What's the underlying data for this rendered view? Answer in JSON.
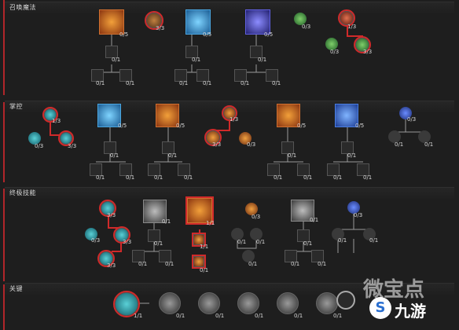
{
  "sections": [
    {
      "title": "召唤魔法"
    },
    {
      "title": "掌控"
    },
    {
      "title": "终极技能"
    },
    {
      "title": "关键"
    }
  ],
  "summoning": {
    "skills": [
      {
        "label": "0/5",
        "icon": "summon-skeleton-icon",
        "color": "#c0591c"
      },
      {
        "label": "3/3",
        "icon": "mod-icon",
        "color": "#c0591c"
      },
      {
        "label": "0/5",
        "icon": "summon-golem-icon",
        "color": "#2a86c4"
      },
      {
        "label": "0/5",
        "icon": "summon-mage-icon",
        "color": "#4a4ad0"
      },
      {
        "label": "0/3",
        "icon": "passive-green-icon",
        "color": "#2c7a3a"
      },
      {
        "label": "1/3",
        "icon": "passive-red-icon",
        "color": "#b83a2a"
      },
      {
        "label": "0/3",
        "icon": "passive-green-icon",
        "color": "#2c7a3a"
      },
      {
        "label": "3/3",
        "icon": "passive-green-icon",
        "color": "#2c7a3a"
      },
      {
        "label": "0/1",
        "icon": "locked-mod-icon"
      },
      {
        "label": "0/1",
        "icon": "locked-mod-icon"
      },
      {
        "label": "0/1",
        "icon": "locked-mod-icon"
      },
      {
        "label": "0/1",
        "icon": "locked-mod-icon"
      },
      {
        "label": "0/1",
        "icon": "locked-mod-icon"
      },
      {
        "label": "0/1",
        "icon": "locked-mod-icon"
      },
      {
        "label": "0/1",
        "icon": "locked-mod-icon"
      },
      {
        "label": "0/1",
        "icon": "locked-mod-icon"
      },
      {
        "label": "0/1",
        "icon": "locked-mod-icon"
      }
    ]
  },
  "mastery": {
    "skills": [
      {
        "label": "1/3",
        "icon": "passive-teal-icon"
      },
      {
        "label": "0/3",
        "icon": "passive-teal-icon"
      },
      {
        "label": "3/3",
        "icon": "passive-teal-icon"
      },
      {
        "label": "0/5",
        "icon": "frost-orb-icon",
        "color": "#2a86c4"
      },
      {
        "label": "0/5",
        "icon": "fire-orb-icon",
        "color": "#c0591c"
      },
      {
        "label": "1/3",
        "icon": "passive-orange-icon"
      },
      {
        "label": "3/3",
        "icon": "passive-orange-icon"
      },
      {
        "label": "0/3",
        "icon": "passive-orange-icon"
      },
      {
        "label": "0/5",
        "icon": "fire-burst-icon",
        "color": "#c0591c"
      },
      {
        "label": "0/5",
        "icon": "vortex-icon",
        "color": "#2a62c4"
      },
      {
        "label": "0/3",
        "icon": "passive-blue-icon"
      },
      {
        "label": "0/1",
        "icon": "locked-mod-icon"
      },
      {
        "label": "0/1",
        "icon": "locked-mod-icon"
      },
      {
        "label": "0/1",
        "icon": "locked-mod-icon"
      },
      {
        "label": "0/1",
        "icon": "locked-mod-icon"
      },
      {
        "label": "0/1",
        "icon": "locked-mod-icon"
      },
      {
        "label": "0/1",
        "icon": "locked-mod-icon"
      },
      {
        "label": "0/1",
        "icon": "locked-mod-icon"
      },
      {
        "label": "0/1",
        "icon": "locked-mod-icon"
      },
      {
        "label": "0/1",
        "icon": "locked-mod-icon"
      },
      {
        "label": "0/1",
        "icon": "locked-mod-icon"
      },
      {
        "label": "0/1",
        "icon": "locked-mod-icon"
      },
      {
        "label": "0/1",
        "icon": "locked-mod-icon"
      },
      {
        "label": "0/1",
        "icon": "locked-mod-icon"
      },
      {
        "label": "0/1",
        "icon": "locked-mod-icon"
      }
    ]
  },
  "ultimate": {
    "skills": [
      {
        "label": "3/3",
        "icon": "passive-teal-icon"
      },
      {
        "label": "0/3",
        "icon": "passive-teal-icon"
      },
      {
        "label": "3/3",
        "icon": "passive-teal-icon"
      },
      {
        "label": "3/3",
        "icon": "passive-teal-icon"
      },
      {
        "label": "0/1",
        "icon": "locked-ultimate-icon"
      },
      {
        "label": "1/1",
        "icon": "fire-ultimate-icon",
        "color": "#c0591c"
      },
      {
        "label": "1/1",
        "icon": "fire-mod-icon"
      },
      {
        "label": "0/1",
        "icon": "fire-mod-icon"
      },
      {
        "label": "0/3",
        "icon": "passive-orange-icon"
      },
      {
        "label": "0/1",
        "icon": "locked-ultimate-icon"
      },
      {
        "label": "0/3",
        "icon": "passive-blue-icon"
      },
      {
        "label": "0/1",
        "icon": "locked-mod-icon"
      },
      {
        "label": "0/1",
        "icon": "locked-mod-icon"
      },
      {
        "label": "0/1",
        "icon": "locked-mod-icon"
      },
      {
        "label": "0/1",
        "icon": "locked-mod-icon"
      },
      {
        "label": "0/1",
        "icon": "locked-mod-icon"
      },
      {
        "label": "0/1",
        "icon": "locked-mod-icon"
      },
      {
        "label": "0/1",
        "icon": "locked-mod-icon"
      },
      {
        "label": "0/1",
        "icon": "locked-mod-icon"
      },
      {
        "label": "0/1",
        "icon": "locked-mod-icon"
      },
      {
        "label": "0/1",
        "icon": "locked-mod-icon"
      },
      {
        "label": "0/1",
        "icon": "locked-mod-icon"
      }
    ]
  },
  "key": {
    "skills": [
      {
        "label": "1/1",
        "icon": "key-passive-teal-icon"
      },
      {
        "label": "0/1",
        "icon": "key-passive-locked-icon"
      },
      {
        "label": "0/1",
        "icon": "key-passive-locked-icon"
      },
      {
        "label": "0/1",
        "icon": "key-passive-locked-icon"
      },
      {
        "label": "0/1",
        "icon": "key-passive-locked-icon"
      },
      {
        "label": "0/1",
        "icon": "key-passive-locked-icon"
      }
    ]
  },
  "watermark": {
    "left": "微宝点",
    "right": "九游"
  }
}
